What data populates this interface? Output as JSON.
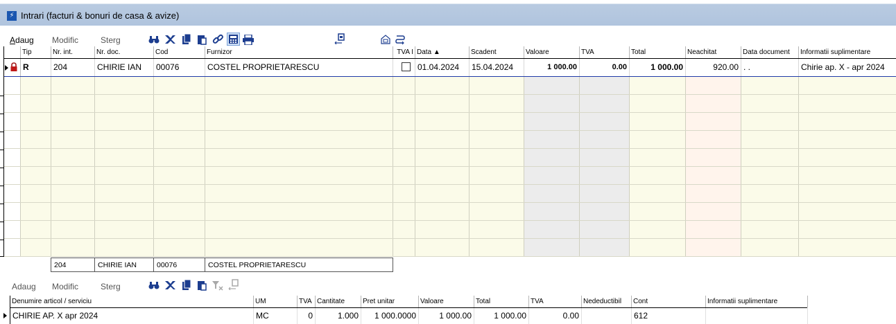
{
  "window": {
    "title": "Intrari (facturi & bonuri de casa & avize)",
    "app_icon": "lightning-icon"
  },
  "toolbar": {
    "add": "Adaug",
    "edit": "Modific",
    "delete": "Sterg",
    "icons": [
      "binoculars-icon",
      "excel-icon",
      "copy-doc-icon",
      "paste-doc-icon",
      "link-icon",
      "calculator-icon",
      "print-icon",
      "export-icon",
      "home-icon",
      "undo-link-icon"
    ]
  },
  "main_grid": {
    "columns": [
      "Tip",
      "Nr. int.",
      "Nr. doc.",
      "Cod",
      "Furnizor",
      "TVA I",
      "Data ▲",
      "Scadent",
      "Valoare",
      "TVA",
      "Total",
      "Neachitat",
      "Data document",
      "Informatii suplimentare"
    ],
    "rows": [
      {
        "locked": true,
        "tip": "R",
        "nr_int": "204",
        "nr_doc": "CHIRIE IAN",
        "cod": "00076",
        "furnizor": "COSTEL PROPRIETARESCU",
        "tva_i": false,
        "data": "01.04.2024",
        "scadent": "15.04.2024",
        "valoare": "1 000.00",
        "tva": "0.00",
        "total": "1 000.00",
        "neachitat": "920.00",
        "data_document": ". .",
        "info": "Chirie ap. X - apr 2024"
      }
    ]
  },
  "summary": {
    "nr_int": "204",
    "nr_doc": "CHIRIE IAN",
    "cod": "00076",
    "furnizor": "COSTEL PROPRIETARESCU"
  },
  "detail_toolbar": {
    "add": "Adaug",
    "edit": "Modific",
    "delete": "Sterg",
    "icons": [
      "binoculars-icon",
      "excel-icon",
      "copy-doc-icon",
      "paste-doc-icon",
      "filter-clear-icon",
      "export-icon"
    ]
  },
  "detail_grid": {
    "columns": [
      "Denumire articol / serviciu",
      "UM",
      "TVA",
      "Cantitate",
      "Pret unitar",
      "Valoare",
      "Total",
      "TVA",
      "Nedeductibil",
      "Cont",
      "Informatii suplimentare"
    ],
    "rows": [
      {
        "denumire": "CHIRIE AP. X apr 2024",
        "um": "MC",
        "tva": "0",
        "cantitate": "1.000",
        "pret_unitar": "1 000.0000",
        "valoare": "1 000.00",
        "total": "1 000.00",
        "tva_val": "0.00",
        "nedeductibil": "",
        "cont": "612",
        "info": ""
      }
    ]
  },
  "colors": {
    "grid_bg": "#fbfbe9",
    "valoare_bg": "#ececec",
    "neachitat_bg": "#fff4ec",
    "selection_line": "#1f3aa8",
    "titlebar": "#b0c4de"
  }
}
